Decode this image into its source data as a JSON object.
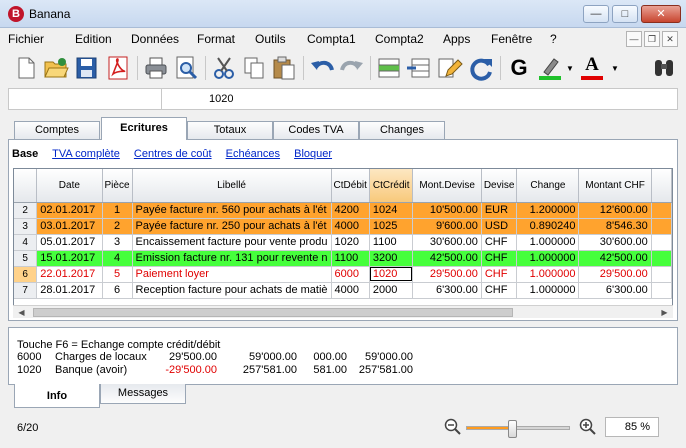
{
  "app": {
    "logo_letter": "B",
    "title": "Banana"
  },
  "window_controls": {
    "minimize": "—",
    "maximize": "□",
    "close": "✕"
  },
  "menu": [
    "Fichier",
    "Edition",
    "Données",
    "Format",
    "Outils",
    "Compta1",
    "Compta2",
    "Apps",
    "Fenêtre",
    "?"
  ],
  "mdi_controls": {
    "minimize": "—",
    "restore": "❐",
    "close": "✕"
  },
  "toolbar": {
    "icons": [
      "new-document-icon",
      "open-folder-icon",
      "save-icon",
      "pdf-icon",
      "print-icon",
      "print-preview-icon",
      "cut-icon",
      "copy-icon",
      "paste-icon",
      "undo-icon",
      "redo-icon",
      "insert-row-icon",
      "delete-row-icon",
      "edit-pencil-icon",
      "refresh-icon",
      "bold-icon",
      "highlight-icon",
      "font-color-icon",
      "binoculars-icon"
    ],
    "bold_glyph": "G",
    "font_color_glyph": "A",
    "highlight_color": "#1fc12b",
    "font_color": "#e00000"
  },
  "address_bar": {
    "value": "1020"
  },
  "tabs": [
    "Comptes",
    "Ecritures",
    "Totaux",
    "Codes TVA",
    "Changes"
  ],
  "active_tab": "Ecritures",
  "subnav": {
    "selected": "Base",
    "links": [
      "TVA complète",
      "Centres de coût",
      "Echéances",
      "Bloquer"
    ]
  },
  "grid": {
    "columns": [
      "",
      "Date",
      "Pièce",
      "Libellé",
      "CtDébit",
      "CtCrédit",
      "Mont.Devise",
      "Devise",
      "Change",
      "Montant CHF",
      ""
    ],
    "highlight_column": "CtCrédit",
    "rows": [
      {
        "n": "2",
        "style": "orange",
        "date": "02.01.2017",
        "piece": "1",
        "libelle": "Payée facture nr. 560 pour achats à l'ét",
        "debit": "4200",
        "credit": "1024",
        "mont_devise": "10'500.00",
        "devise": "EUR",
        "change": "1.200000",
        "montant_chf": "12'600.00"
      },
      {
        "n": "3",
        "style": "orange",
        "date": "03.01.2017",
        "piece": "2",
        "libelle": "Payée facture nr. 250 pour achats à l'ét",
        "debit": "4000",
        "credit": "1025",
        "mont_devise": "9'600.00",
        "devise": "USD",
        "change": "0.890240",
        "montant_chf": "8'546.30"
      },
      {
        "n": "4",
        "style": "white",
        "date": "05.01.2017",
        "piece": "3",
        "libelle": "Encaissement facture pour vente produ",
        "debit": "1020",
        "credit": "1100",
        "mont_devise": "30'600.00",
        "devise": "CHF",
        "change": "1.000000",
        "montant_chf": "30'600.00"
      },
      {
        "n": "5",
        "style": "green",
        "date": "15.01.2017",
        "piece": "4",
        "libelle": "Emission facture nr. 131 pour revente n",
        "debit": "1100",
        "credit": "3200",
        "mont_devise": "42'500.00",
        "devise": "CHF",
        "change": "1.000000",
        "montant_chf": "42'500.00"
      },
      {
        "n": "6",
        "style": "red",
        "date": "22.01.2017",
        "piece": "5",
        "libelle": "Paiement loyer",
        "debit": "6000",
        "credit": "1020",
        "mont_devise": "29'500.00",
        "devise": "CHF",
        "change": "1.000000",
        "montant_chf": "29'500.00"
      },
      {
        "n": "7",
        "style": "white",
        "date": "28.01.2017",
        "piece": "6",
        "libelle": "Reception facture pour achats de matiè",
        "debit": "4000",
        "credit": "2000",
        "mont_devise": "6'300.00",
        "devise": "CHF",
        "change": "1.000000",
        "montant_chf": "6'300.00"
      }
    ]
  },
  "info": {
    "hint": "Touche F6 = Echange compte crédit/débit",
    "lines": [
      {
        "account": "6000",
        "label": "Charges de locaux",
        "amount": "29'500.00",
        "balance": "59'000.00",
        "col3": "000.00",
        "col4": "59'000.00",
        "negative": false
      },
      {
        "account": "1020",
        "label": "Banque (avoir)",
        "amount": "-29'500.00",
        "balance": "257'581.00",
        "col3": "581.00",
        "col4": "257'581.00",
        "negative": true
      }
    ]
  },
  "bottom_tabs": [
    "Info",
    "Messages"
  ],
  "status": {
    "position": "6/20",
    "zoom": "85 %",
    "zoom_level": 0.44
  }
}
